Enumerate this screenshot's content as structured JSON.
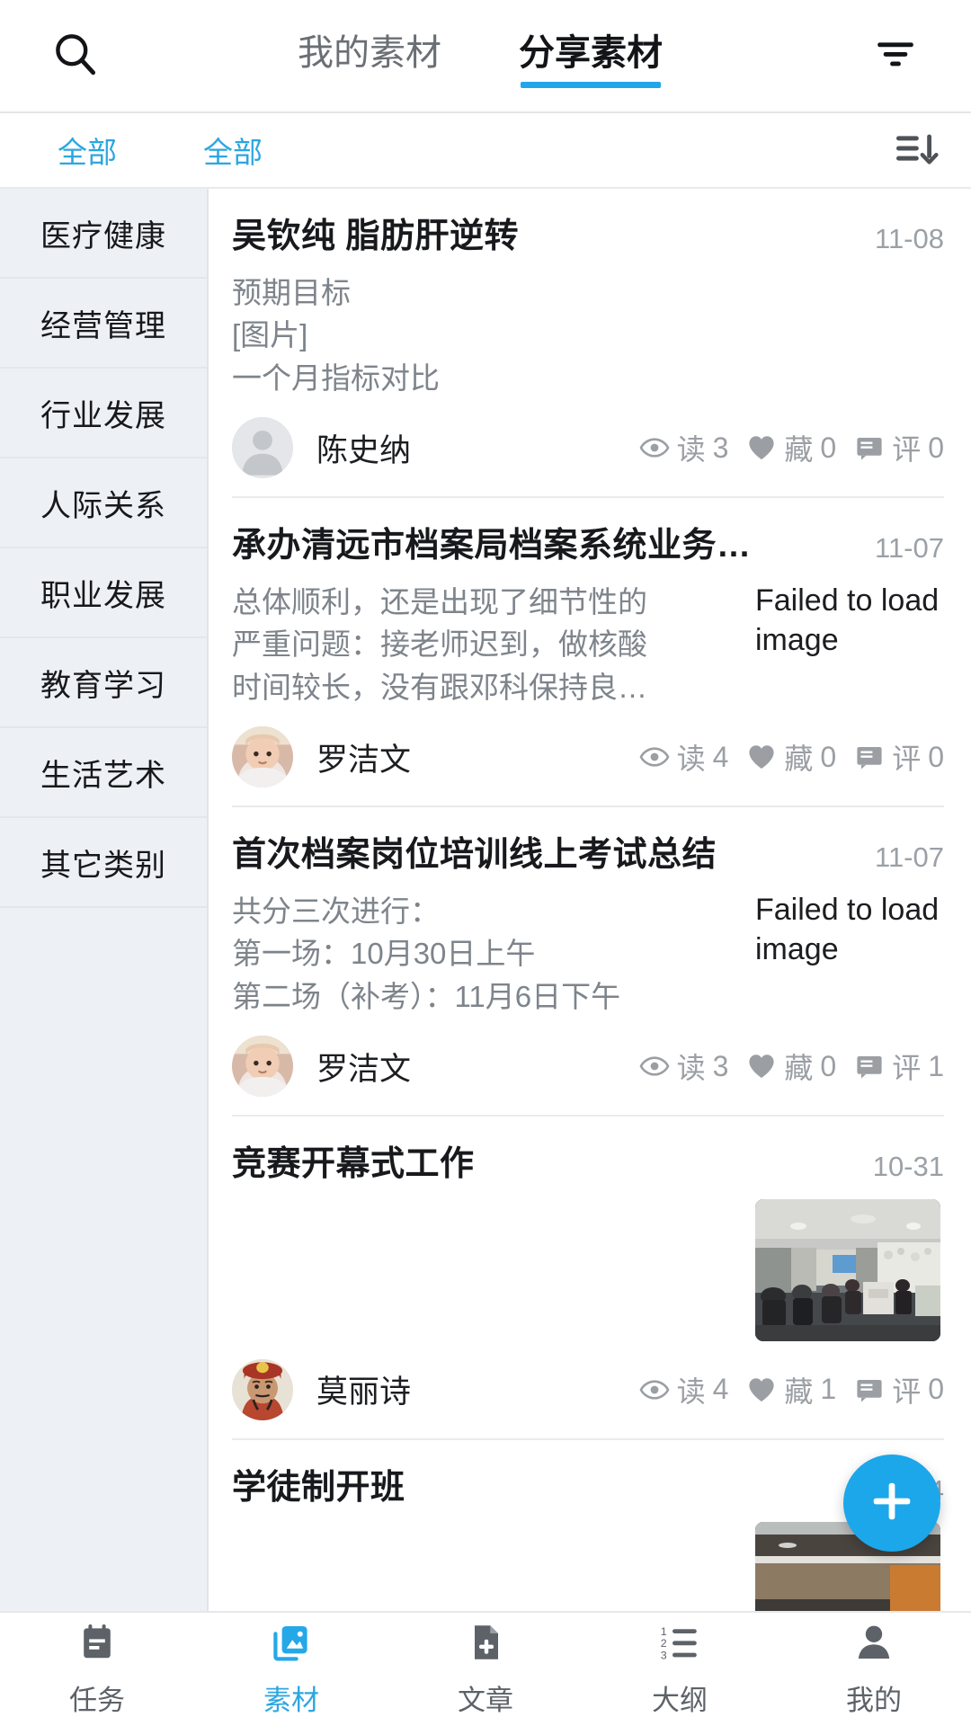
{
  "theme": {
    "accent": "#2ca6e0",
    "accent_strong": "#1ba7ea",
    "sidebar_bg": "#edf1f5",
    "muted_text": "#9aa0a6",
    "title_text": "#18191c"
  },
  "topbar": {
    "search_icon": "search-icon",
    "filter_icon": "filter-icon",
    "tabs": [
      {
        "label": "我的素材",
        "active": false
      },
      {
        "label": "分享素材",
        "active": true
      }
    ]
  },
  "filterbar": {
    "chip_one": "全部",
    "chip_two": "全部",
    "sort_icon": "sort-descending-icon"
  },
  "sidebar": {
    "items": [
      {
        "label": "医疗健康"
      },
      {
        "label": "经营管理"
      },
      {
        "label": "行业发展"
      },
      {
        "label": "人际关系"
      },
      {
        "label": "职业发展"
      },
      {
        "label": "教育学习"
      },
      {
        "label": "生活艺术"
      },
      {
        "label": "其它类别"
      }
    ]
  },
  "feed": {
    "cards": [
      {
        "title": "吴钦纯 脂肪肝逆转",
        "date": "11-08",
        "snippet_lines": [
          "预期目标",
          "[图片]",
          "一个月指标对比"
        ],
        "thumb_type": "none",
        "thumb_text": "",
        "author": "陈史纳",
        "avatar_type": "placeholder",
        "stats": {
          "read_label": "读",
          "read_count": "3",
          "fav_label": "藏",
          "fav_count": "0",
          "comment_label": "评",
          "comment_count": "0"
        }
      },
      {
        "title": "承办清远市档案局档案系统业务…",
        "date": "11-07",
        "snippet_lines": [
          "总体顺利，还是出现了细节性的",
          "严重问题：接老师迟到，做核酸",
          "时间较长，没有跟邓科保持良…"
        ],
        "thumb_type": "failed",
        "thumb_text": "Failed to load image",
        "author": "罗洁文",
        "avatar_type": "baby",
        "stats": {
          "read_label": "读",
          "read_count": "4",
          "fav_label": "藏",
          "fav_count": "0",
          "comment_label": "评",
          "comment_count": "0"
        }
      },
      {
        "title": "首次档案岗位培训线上考试总结",
        "date": "11-07",
        "snippet_lines": [
          "共分三次进行：",
          "第一场：10月30日上午",
          "第二场（补考）：11月6日下午"
        ],
        "thumb_type": "failed",
        "thumb_text": "Failed to load image",
        "author": "罗洁文",
        "avatar_type": "baby",
        "stats": {
          "read_label": "读",
          "read_count": "3",
          "fav_label": "藏",
          "fav_count": "0",
          "comment_label": "评",
          "comment_count": "1"
        }
      },
      {
        "title": "竞赛开幕式工作",
        "date": "10-31",
        "snippet_lines": [],
        "thumb_type": "photo",
        "thumb_text": "",
        "author": "莫丽诗",
        "avatar_type": "portrait",
        "stats": {
          "read_label": "读",
          "read_count": "4",
          "fav_label": "藏",
          "fav_count": "1",
          "comment_label": "评",
          "comment_count": "0"
        }
      },
      {
        "title": "学徒制开班",
        "date": "4",
        "snippet_lines": [],
        "thumb_type": "photo",
        "thumb_text": "",
        "author": "",
        "avatar_type": "none",
        "stats": {
          "read_label": "",
          "read_count": "",
          "fav_label": "",
          "fav_count": "",
          "comment_label": "",
          "comment_count": ""
        }
      }
    ]
  },
  "fab": {
    "icon": "plus-icon",
    "label": "+"
  },
  "bottomnav": {
    "items": [
      {
        "label": "任务",
        "icon": "calendar-task-icon",
        "active": false
      },
      {
        "label": "素材",
        "icon": "image-library-icon",
        "active": true
      },
      {
        "label": "文章",
        "icon": "document-add-icon",
        "active": false
      },
      {
        "label": "大纲",
        "icon": "numbered-list-icon",
        "active": false
      },
      {
        "label": "我的",
        "icon": "person-icon",
        "active": false
      }
    ]
  }
}
